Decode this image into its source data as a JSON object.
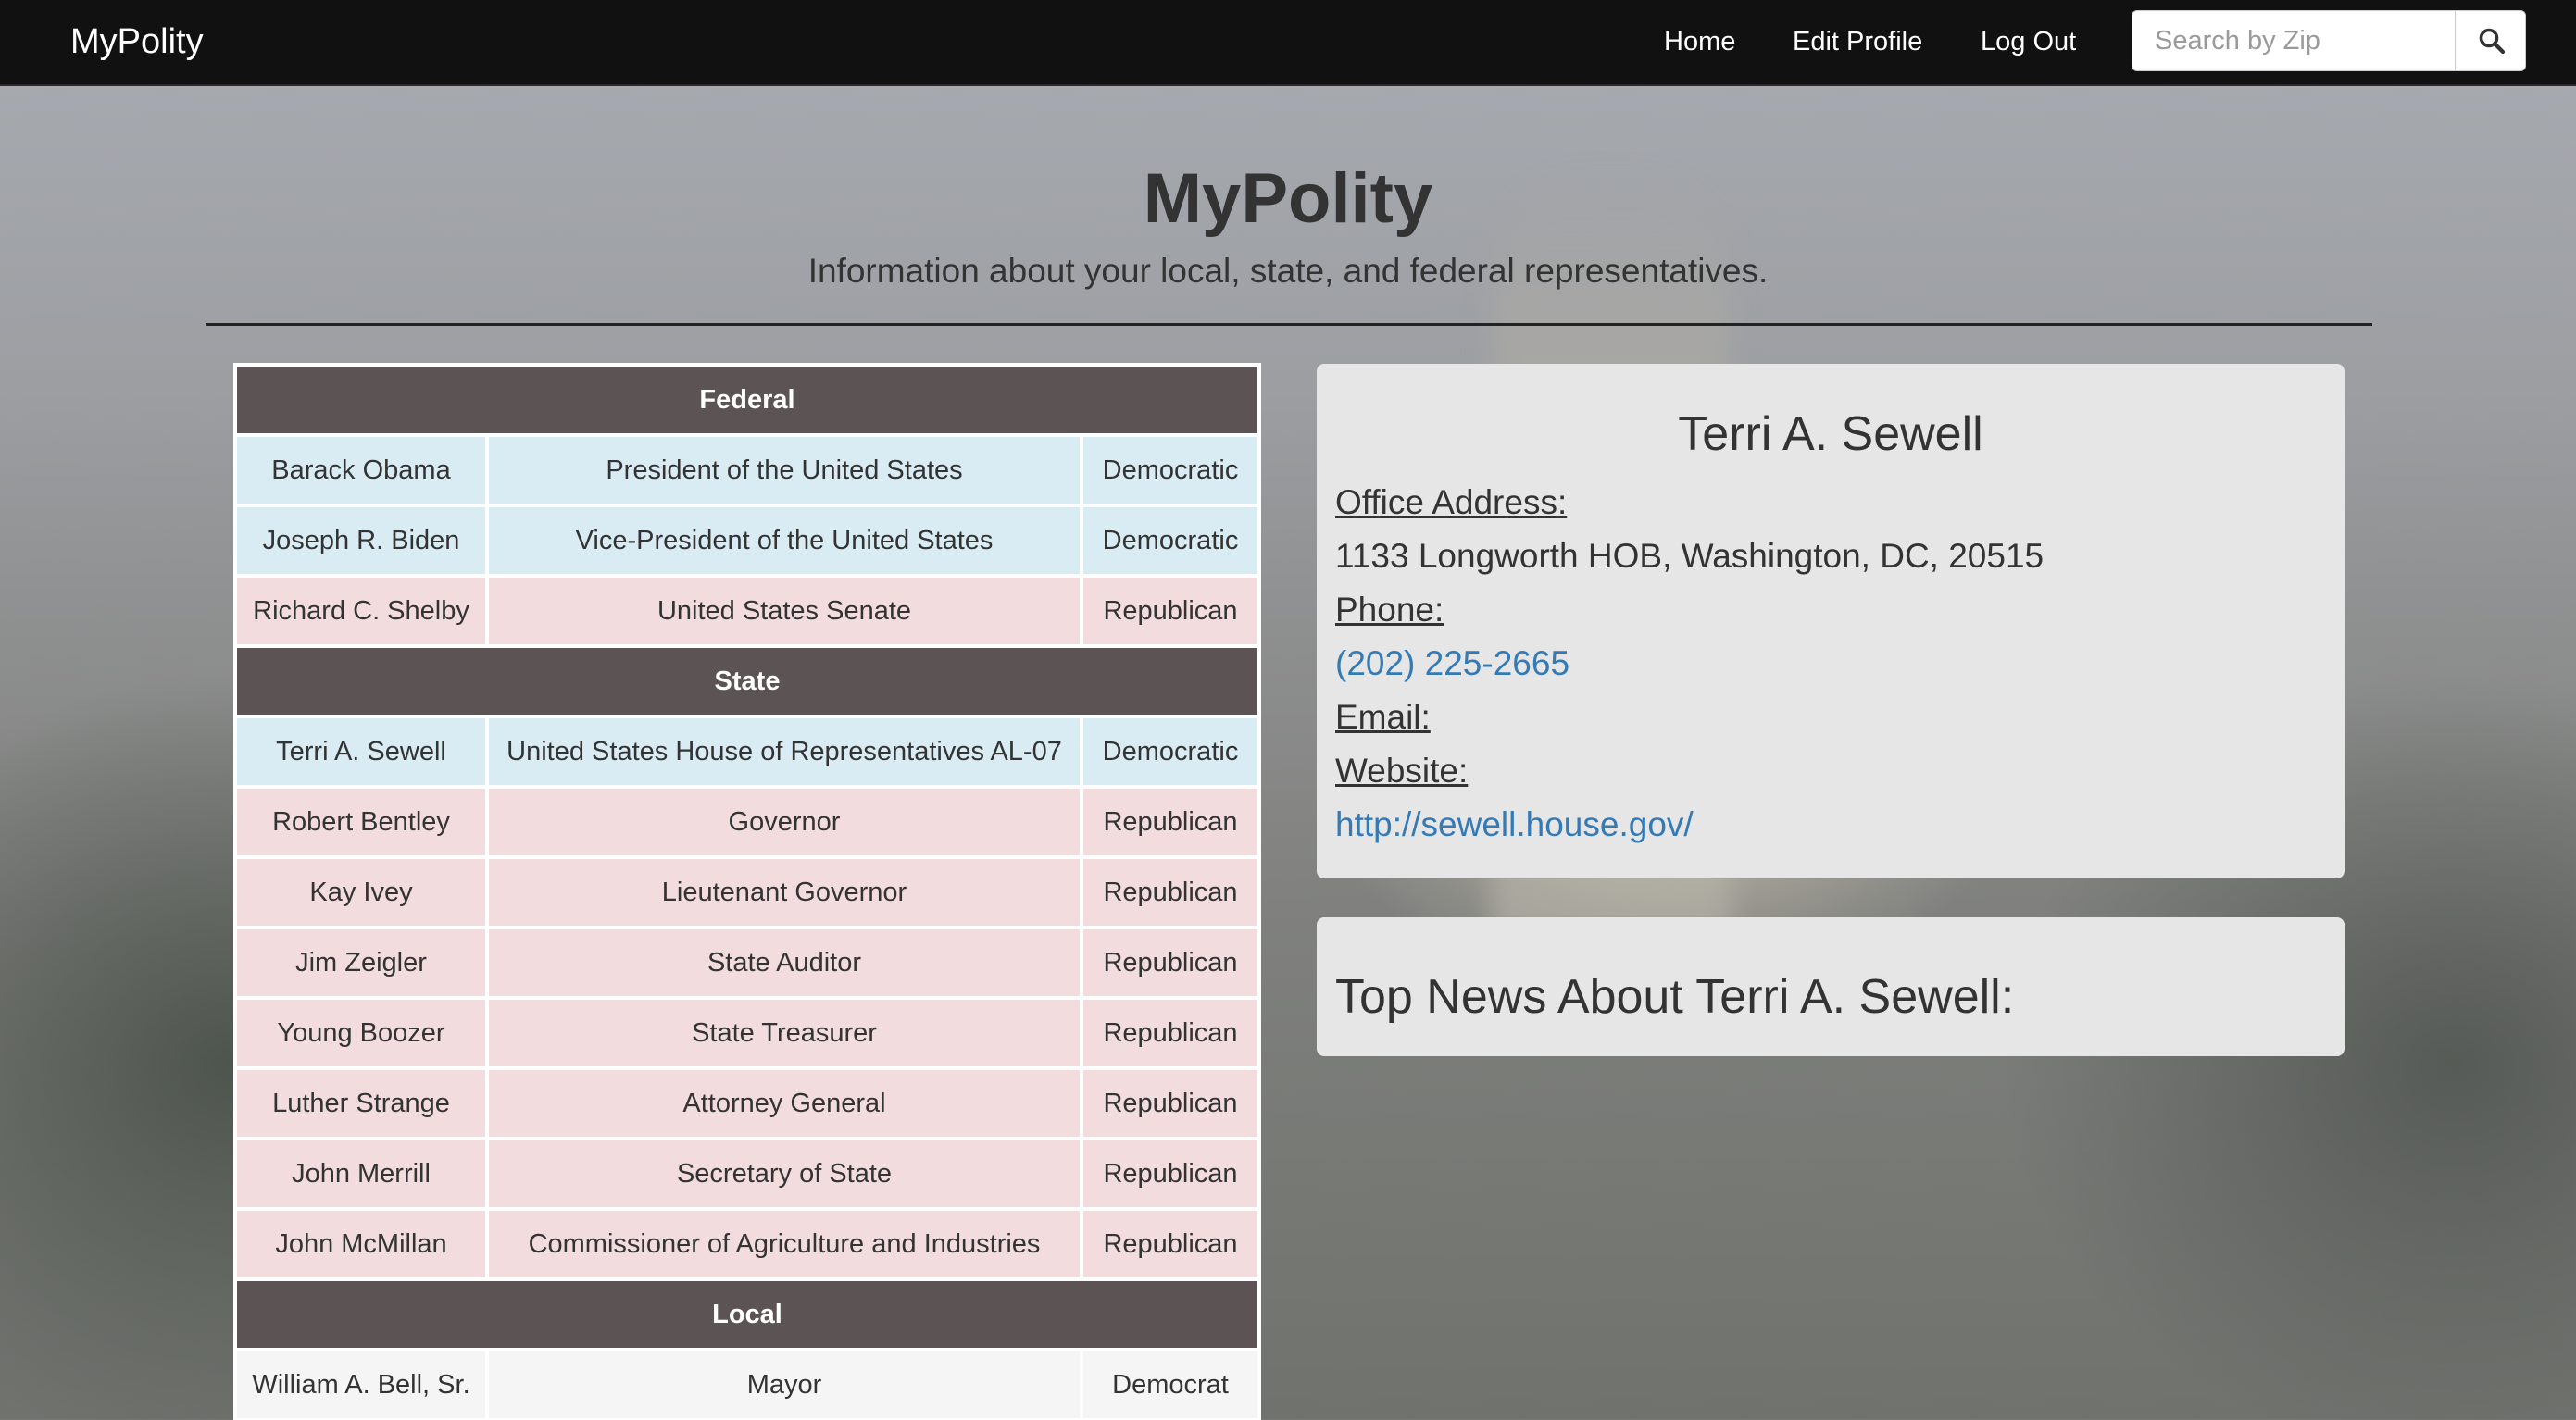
{
  "navbar": {
    "brand": "MyPolity",
    "links": [
      "Home",
      "Edit Profile",
      "Log Out"
    ],
    "search_placeholder": "Search by Zip",
    "search_icon": "search-icon"
  },
  "header": {
    "title": "MyPolity",
    "subtitle": "Information about your local, state, and federal representatives."
  },
  "colors": {
    "democratic_row": "#d9ebf3",
    "republican_row": "#f2dcde",
    "section_header": "#5c5454",
    "link": "#337ab7"
  },
  "sections": [
    {
      "title": "Federal",
      "rows": [
        {
          "name": "Barack Obama",
          "office": "President of the United States",
          "party": "Democratic"
        },
        {
          "name": "Joseph R. Biden",
          "office": "Vice-President of the United States",
          "party": "Democratic"
        },
        {
          "name": "Richard C. Shelby",
          "office": "United States Senate",
          "party": "Republican"
        }
      ]
    },
    {
      "title": "State",
      "rows": [
        {
          "name": "Terri A. Sewell",
          "office": "United States House of Representatives AL-07",
          "party": "Democratic"
        },
        {
          "name": "Robert Bentley",
          "office": "Governor",
          "party": "Republican"
        },
        {
          "name": "Kay Ivey",
          "office": "Lieutenant Governor",
          "party": "Republican"
        },
        {
          "name": "Jim Zeigler",
          "office": "State Auditor",
          "party": "Republican"
        },
        {
          "name": "Young Boozer",
          "office": "State Treasurer",
          "party": "Republican"
        },
        {
          "name": "Luther Strange",
          "office": "Attorney General",
          "party": "Republican"
        },
        {
          "name": "John Merrill",
          "office": "Secretary of State",
          "party": "Republican"
        },
        {
          "name": "John McMillan",
          "office": "Commissioner of Agriculture and Industries",
          "party": "Republican"
        }
      ]
    },
    {
      "title": "Local",
      "rows": [
        {
          "name": "William A. Bell, Sr.",
          "office": "Mayor",
          "party": "Democrat"
        }
      ]
    }
  ],
  "detail": {
    "name": "Terri A. Sewell",
    "office_label": "Office Address:",
    "office_address": "1133 Longworth HOB, Washington, DC, 20515",
    "phone_label": "Phone:",
    "phone": "(202) 225-2665",
    "email_label": "Email:",
    "website_label": "Website:",
    "website": "http://sewell.house.gov/"
  },
  "news": {
    "heading": "Top News About Terri A. Sewell:"
  }
}
